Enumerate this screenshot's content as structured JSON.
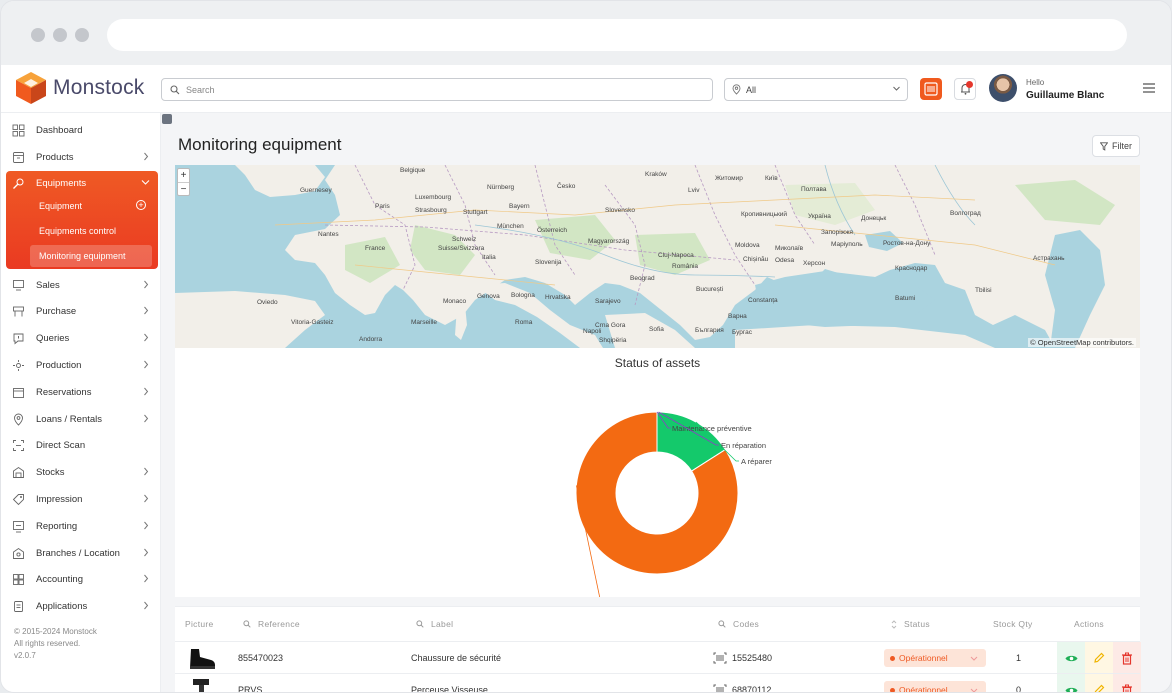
{
  "app": {
    "name": "Monstock",
    "brand_color": "#ef5a24"
  },
  "header": {
    "search_placeholder": "Search",
    "location_value": "All",
    "greeting": "Hello",
    "user_name": "Guillaume Blanc",
    "notification_count": "1"
  },
  "sidebar": {
    "items": [
      {
        "label": "Dashboard",
        "icon": "dashboard-icon",
        "arrow": false
      },
      {
        "label": "Products",
        "icon": "products-icon",
        "arrow": true
      },
      {
        "label": "Sales",
        "icon": "sales-icon",
        "arrow": true
      },
      {
        "label": "Purchase",
        "icon": "purchase-icon",
        "arrow": true
      },
      {
        "label": "Queries",
        "icon": "queries-icon",
        "arrow": true
      },
      {
        "label": "Production",
        "icon": "production-icon",
        "arrow": true
      },
      {
        "label": "Reservations",
        "icon": "calendar-icon",
        "arrow": true
      },
      {
        "label": "Loans / Rentals",
        "icon": "location-pin-icon",
        "arrow": true
      },
      {
        "label": "Direct Scan",
        "icon": "scan-icon",
        "arrow": false
      },
      {
        "label": "Stocks",
        "icon": "warehouse-icon",
        "arrow": true
      },
      {
        "label": "Impression",
        "icon": "tag-icon",
        "arrow": true
      },
      {
        "label": "Reporting",
        "icon": "report-icon",
        "arrow": true
      },
      {
        "label": "Branches / Location",
        "icon": "branch-icon",
        "arrow": true
      },
      {
        "label": "Accounting",
        "icon": "accounting-icon",
        "arrow": true
      },
      {
        "label": "Applications",
        "icon": "applications-icon",
        "arrow": true
      }
    ],
    "equipments": {
      "label": "Equipments",
      "sub": [
        "Equipment",
        "Equipments control",
        "Monitoring equipment"
      ],
      "active": "Monitoring equipment"
    },
    "footer": [
      "© 2015-2024 Monstock",
      "All rights reserved.",
      "v2.0.7"
    ]
  },
  "page": {
    "title": "Monitoring equipment",
    "filter_label": "Filter"
  },
  "map": {
    "attribution": "© OpenStreetMap contributors.",
    "zoom_in": "+",
    "zoom_out": "−",
    "labels": [
      "Guernesey",
      "Belgique",
      "Luxembourg",
      "Nürnberg",
      "Česko",
      "Paris",
      "Strasbourg",
      "Stuttgart",
      "Bayern",
      "Nantes",
      "München",
      "Österreich",
      "Slovensko",
      "Magyarország",
      "France",
      "Schweiz",
      "Suisse/Svizzera",
      "Italia",
      "Slovenija",
      "Hrvatska",
      "Genova",
      "Bologna",
      "Monaco",
      "Oviedo",
      "Vitoria-Gasteiz",
      "Marseille",
      "Andorra",
      "Roma",
      "Napoli",
      "Sarajevo",
      "Crna Gora",
      "Shqipëria",
      "Beograd",
      "Cluj-Napoca",
      "România",
      "București",
      "Sofia",
      "Moldova",
      "Chișinău",
      "Odesa",
      "Київ",
      "Україна",
      "Запоріжжя",
      "Донецьк",
      "Полтава",
      "Волгоград",
      "Ростов-на-Дону",
      "Краснодар",
      "Астрахань",
      "Batumi",
      "Tbilisi",
      "Житомир",
      "Кропивницький",
      "Миколаїв",
      "Херсон",
      "Маріуполь",
      "Constanța",
      "Варна",
      "Бургас",
      "България",
      "Kraków",
      "Lviv"
    ]
  },
  "chart_data": {
    "type": "pie",
    "title": "Status of assets",
    "categories": [
      "Opérationnel",
      "Maintenance préventive",
      "En réparation",
      "A réparer"
    ],
    "values": [
      84,
      0,
      0,
      16
    ],
    "colors": [
      "#f36a12",
      "#8f3cc7",
      "#8f3cc7",
      "#14c96b"
    ],
    "donut": true
  },
  "table": {
    "headers": [
      "Picture",
      "Reference",
      "Label",
      "Codes",
      "Status",
      "Stock Qty",
      "Actions"
    ],
    "rows": [
      {
        "reference": "855470023",
        "label": "Chaussure de sécurité",
        "code": "15525480",
        "status": "Opérationnel",
        "qty": "1"
      },
      {
        "reference": "PRVS",
        "label": "Perceuse Visseuse",
        "code": "68870112",
        "status": "Opérationnel",
        "qty": "0"
      }
    ]
  }
}
